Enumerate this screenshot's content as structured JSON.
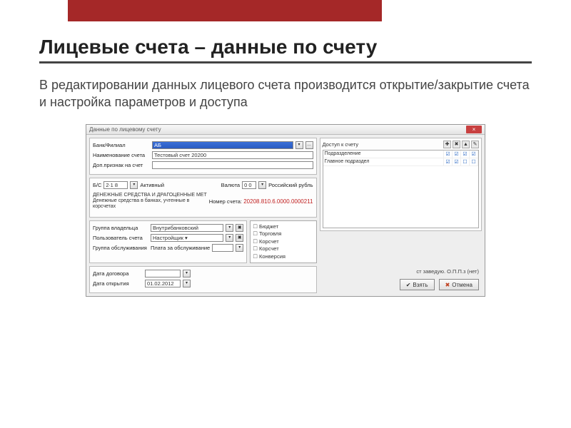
{
  "slide": {
    "title": "Лицевые счета – данные по счету",
    "subtitle": "В редактировании данных лицевого счета производится открытие/закрытие счета и настройка параметров и доступа"
  },
  "win": {
    "title": "Данные по лицевому счету",
    "close": "×",
    "fields": {
      "bank_lbl": "Банк/Филиал",
      "bank_val": "АБ",
      "name_lbl": "Наименование счета",
      "name_val": "Тестовый счет 20200",
      "extra_lbl": "Доп.признак на счет",
      "bs_lbl": "Б/С",
      "bs_val": "2∙1 8",
      "active_lbl": "Активный",
      "currency_lbl": "Валюта",
      "currency_code": "0 0",
      "currency_name": "Российский рубль",
      "desc_line1": "ДЕНЕЖНЫЕ СРЕДСТВА И ДРАГОЦЕННЫЕ МЕТ",
      "desc_line2": "Денежные средства в банках, учтенные в корсчетах",
      "acct_num_lbl": "Номер счета:",
      "acct_num": "20208.810.6.0000.0000211",
      "owner_group_lbl": "Группа владельца",
      "owner_group_val": "Внутрибанковский",
      "user_lbl": "Пользователь счета",
      "user_val": "Настройщик ▾",
      "service_group_lbl": "Группа обслуживания",
      "service_fee_lbl": "Плата за обслуживание",
      "contract_date_lbl": "Дата договора",
      "open_date_lbl": "Дата открытия",
      "open_date_val": "01.02.2012"
    },
    "checklist": {
      "items": [
        "Бюджет",
        "Торговля",
        "Корсчет",
        "Корсчет",
        "Конверсия"
      ]
    },
    "perms": {
      "title": "Доступ к счету",
      "row1": "Подразделение",
      "row2": "Главное подраздел"
    },
    "author": "ст заведую. О.П.П.з (нет)",
    "buttons": {
      "ok": "Взять",
      "cancel": "Отмена"
    }
  }
}
